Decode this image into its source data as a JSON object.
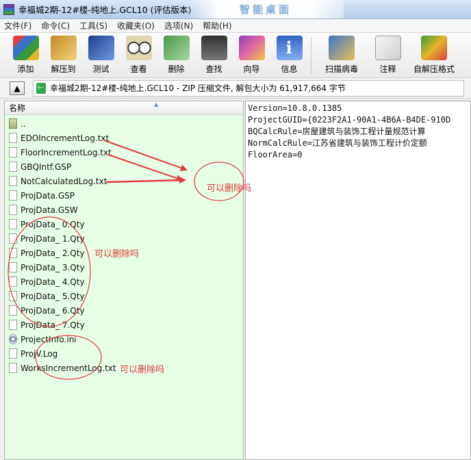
{
  "window": {
    "title": "幸福城2期-12#楼-纯地上.GCL10 (评估版本)",
    "overlay_text": "智能桌面"
  },
  "menu": [
    "文件(F)",
    "命令(C)",
    "工具(S)",
    "收藏夹(O)",
    "选项(N)",
    "帮助(H)"
  ],
  "toolbar": [
    {
      "label": "添加",
      "icon": "add-archive-icon"
    },
    {
      "label": "解压到",
      "icon": "extract-to-icon"
    },
    {
      "label": "测试",
      "icon": "test-icon"
    },
    {
      "label": "查看",
      "icon": "view-icon"
    },
    {
      "label": "删除",
      "icon": "delete-icon"
    },
    {
      "label": "查找",
      "icon": "find-binoculars-icon"
    },
    {
      "label": "向导",
      "icon": "wizard-icon"
    },
    {
      "label": "信息",
      "icon": "info-icon"
    },
    {
      "label": "扫描病毒",
      "icon": "virus-scan-icon"
    },
    {
      "label": "注释",
      "icon": "comment-icon"
    },
    {
      "label": "自解压格式",
      "icon": "sfx-icon"
    }
  ],
  "address": {
    "up_icon": "up-folder-icon",
    "zip_icon_glyph": "⊢",
    "text": "幸福城2期-12#楼-纯地上.GCL10 - ZIP 压缩文件, 解包大小为 61,917,664 字节"
  },
  "file_pane": {
    "column_header": "名称",
    "sort_glyph": "▲",
    "files": [
      {
        "name": "..",
        "type": "folder"
      },
      {
        "name": "EDOIncrementLog.txt",
        "type": "file"
      },
      {
        "name": "FloorIncrementLog.txt",
        "type": "file"
      },
      {
        "name": "GBQIntf.GSP",
        "type": "file"
      },
      {
        "name": "NotCalculatedLog.txt",
        "type": "file"
      },
      {
        "name": "ProjData.GSP",
        "type": "file"
      },
      {
        "name": "ProjData.GSW",
        "type": "file"
      },
      {
        "name": "ProjData_ 0.Qty",
        "type": "file"
      },
      {
        "name": "ProjData_ 1.Qty",
        "type": "file"
      },
      {
        "name": "ProjData_ 2.Qty",
        "type": "file"
      },
      {
        "name": "ProjData_ 3.Qty",
        "type": "file"
      },
      {
        "name": "ProjData_ 4.Qty",
        "type": "file"
      },
      {
        "name": "ProjData_ 5.Qty",
        "type": "file"
      },
      {
        "name": "ProjData_ 6.Qty",
        "type": "file"
      },
      {
        "name": "ProjData_ 7.Qty",
        "type": "file"
      },
      {
        "name": "ProjectInfo.ini",
        "type": "settings"
      },
      {
        "name": "ProjV.Log",
        "type": "file"
      },
      {
        "name": "WorksIncrementLog.txt",
        "type": "file"
      }
    ]
  },
  "text_pane": {
    "lines": [
      "Version=10.8.0.1385",
      "ProjectGUID={0223F2A1-90A1-4B6A-B4DE-910D",
      "BQCalcRule=房屋建筑与装饰工程计量规范计算",
      "NormCalcRule=江苏省建筑与装饰工程计价定额",
      "FloorArea=0"
    ]
  },
  "annotations": {
    "color": "#e23a3a",
    "notes": [
      "可以删除吗",
      "可以删除吗",
      "可以删除吗"
    ]
  }
}
